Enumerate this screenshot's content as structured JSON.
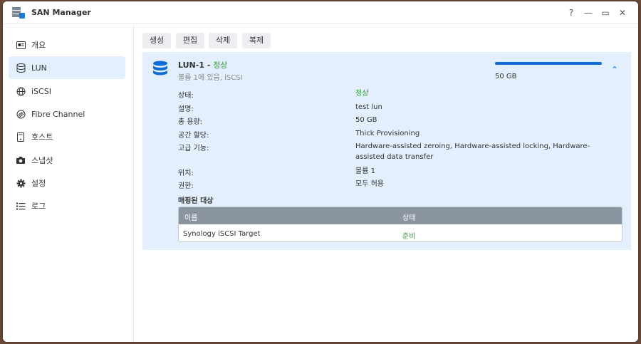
{
  "window": {
    "title": "SAN Manager",
    "controls": [
      "?",
      "—",
      "▭",
      "✕"
    ]
  },
  "sidebar": {
    "items": [
      {
        "label": "개요",
        "icon": "overview-icon"
      },
      {
        "label": "LUN",
        "icon": "database-icon",
        "active": true
      },
      {
        "label": "iSCSI",
        "icon": "globe-icon"
      },
      {
        "label": "Fibre Channel",
        "icon": "fibre-channel-icon"
      },
      {
        "label": "호스트",
        "icon": "host-icon"
      },
      {
        "label": "스냅샷",
        "icon": "camera-icon"
      },
      {
        "label": "설정",
        "icon": "gear-icon"
      },
      {
        "label": "로그",
        "icon": "list-icon"
      }
    ]
  },
  "toolbar": {
    "create": "생성",
    "edit": "편집",
    "delete": "삭제",
    "clone": "복제"
  },
  "lun": {
    "name": "LUN-1",
    "separator": " - ",
    "status": "정상",
    "subtitle": "볼륨 1에 있음, iSCSI",
    "usage_label": "50 GB",
    "usage_fraction": 1.0,
    "details": [
      {
        "label": "상태:",
        "value": "정상",
        "color": "#2e9e2e"
      },
      {
        "label": "설명:",
        "value": "test lun"
      },
      {
        "label": "총 용량:",
        "value": "50 GB"
      },
      {
        "label": "공간 할당:",
        "value": "Thick Provisioning"
      },
      {
        "label": "고급 기능:",
        "value": "Hardware-assisted zeroing, Hardware-assisted locking, Hardware-assisted data transfer"
      },
      {
        "label": "위치:",
        "value": "볼륨 1"
      },
      {
        "label": "권한:",
        "value": "모두 허용"
      }
    ],
    "mapped_title": "매핑된 대상",
    "table": {
      "headers": [
        "이름",
        "상태"
      ],
      "rows": [
        [
          "Synology iSCSI Target",
          "준비"
        ]
      ]
    }
  },
  "colors": {
    "accent": "#0d6cd6",
    "active_bg": "#e3effc",
    "ok": "#2e9e2e"
  }
}
